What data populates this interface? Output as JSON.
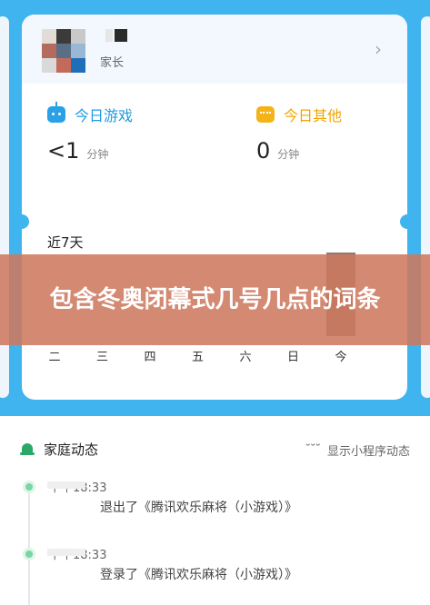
{
  "profile": {
    "role": "家长"
  },
  "stats": {
    "today_games_label": "今日游戏",
    "today_games_value": "<1",
    "today_games_unit": "分钟",
    "today_other_label": "今日其他",
    "today_other_value": "0",
    "today_other_unit": "分钟"
  },
  "week": {
    "label": "近7天",
    "days": [
      "二",
      "三",
      "四",
      "五",
      "六",
      "日",
      "今"
    ],
    "values": [
      0,
      0,
      0,
      0,
      0,
      0,
      1
    ]
  },
  "banner": {
    "text": "包含冬奥闭幕式几号几点的词条"
  },
  "family": {
    "title": "家庭动态",
    "show_mini_label": "显示小程序动态",
    "events": [
      {
        "time": "下午18:33",
        "text": "退出了《腾讯欢乐麻将（小游戏）》"
      },
      {
        "time": "下午18:33",
        "text": "登录了《腾讯欢乐麻将（小游戏）》"
      }
    ]
  },
  "colors": {
    "header_bg": "#3fb4ee",
    "games_accent": "#1c9be0",
    "other_accent": "#f0a500",
    "banner_bg": "#ce795f",
    "timeline_dot": "#7ad6a3"
  }
}
